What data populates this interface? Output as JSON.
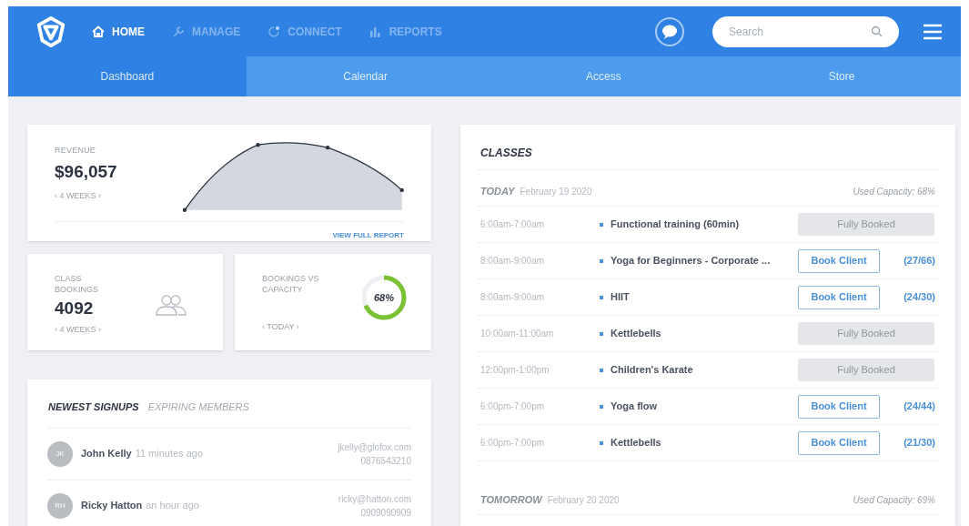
{
  "nav": [
    {
      "label": "HOME",
      "selected": true
    },
    {
      "label": "MANAGE",
      "selected": false
    },
    {
      "label": "CONNECT",
      "selected": false
    },
    {
      "label": "REPORTS",
      "selected": false
    }
  ],
  "search": {
    "placeholder": "Search"
  },
  "tabs": [
    {
      "label": "Dashboard",
      "selected": true
    },
    {
      "label": "Calendar",
      "selected": false
    },
    {
      "label": "Access",
      "selected": false
    },
    {
      "label": "Store",
      "selected": false
    }
  ],
  "revenue": {
    "label": "REVENUE",
    "value": "$96,057",
    "period": "‹ 4 WEEKS ›",
    "link": "VIEW FULL REPORT"
  },
  "class_bookings": {
    "label": "CLASS BOOKINGS",
    "value": "4092",
    "period": "‹ 4 WEEKS ›"
  },
  "capacity": {
    "label": "BOOKINGS VS CAPACITY",
    "level": 0.68,
    "reading": "68%",
    "period": "‹ TODAY ›"
  },
  "signups": {
    "tabs": [
      {
        "label": "NEWEST SIGNUPS",
        "selected": true
      },
      {
        "label": "EXPIRING MEMBERS",
        "selected": false
      }
    ],
    "members": [
      {
        "initials": "JK",
        "name": "John Kelly",
        "time": "11 minutes ago",
        "email": "jkelly@glofox.com",
        "phone": "0876543210"
      },
      {
        "initials": "RH",
        "name": "Ricky Hatton",
        "time": "an hour ago",
        "email": "ricky@hatton.com",
        "phone": "0909090909"
      }
    ]
  },
  "classes": {
    "title": "CLASSES",
    "days": [
      {
        "day": "TODAY",
        "date": "February 19 2020",
        "capacity": "Used Capacity: 68%",
        "rows": [
          {
            "time": "6:00am-7:00am",
            "name": "Functional training (60min)",
            "kind": "full",
            "button": "Fully Booked"
          },
          {
            "time": "8:00am-9:00am",
            "name": "Yoga for Beginners - Corporate ...",
            "kind": "open",
            "button": "Book Client",
            "count": "(27/66)"
          },
          {
            "time": "8:00am-9:00am",
            "name": "HIIT",
            "kind": "open",
            "button": "Book Client",
            "count": "(24/30)"
          },
          {
            "time": "10:00am-11:00am",
            "name": "Kettlebells",
            "kind": "full",
            "button": "Fully Booked"
          },
          {
            "time": "12:00pm-1:00pm",
            "name": "Children's Karate",
            "kind": "full",
            "button": "Fully Booked"
          },
          {
            "time": "6:00pm-7:00pm",
            "name": "Yoga flow",
            "kind": "open",
            "button": "Book Client",
            "count": "(24/44)"
          },
          {
            "time": "6:00pm-7:00pm",
            "name": "Kettlebells",
            "kind": "open",
            "button": "Book Client",
            "count": "(21/30)"
          }
        ]
      },
      {
        "day": "TOMORROW",
        "date": "February 20 2020",
        "capacity": "Used Capacity: 69%"
      }
    ]
  }
}
